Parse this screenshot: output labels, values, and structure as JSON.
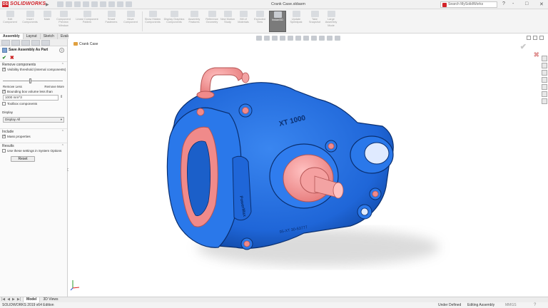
{
  "app": {
    "brand": "SOLIDWORKS",
    "document_title": "Crank Case.sldasm",
    "search_placeholder": "Search MySolidWorks",
    "window_controls": [
      "?",
      "-",
      "□",
      "✕"
    ]
  },
  "commands": [
    {
      "label": "Edit Component"
    },
    {
      "label": "Insert Components"
    },
    {
      "label": "Mate"
    },
    {
      "label": "Component Preview Window"
    },
    {
      "label": "Linear Component Pattern"
    },
    {
      "label": "Smart Fasteners"
    },
    {
      "label": "Move Component"
    },
    {
      "label": "Show Hidden Components"
    },
    {
      "label": "Display Graphics Components"
    },
    {
      "label": "Assembly Features"
    },
    {
      "label": "Reference Geometry"
    },
    {
      "label": "New Motion Study"
    },
    {
      "label": "Bill of Materials"
    },
    {
      "label": "Exploded View"
    },
    {
      "label": "Instant3D"
    },
    {
      "label": "Update Speedpak"
    },
    {
      "label": "Take Snapshot"
    },
    {
      "label": "Large Assembly Mode"
    }
  ],
  "tabs": [
    "Assembly",
    "Layout",
    "Sketch",
    "Evaluate"
  ],
  "property_manager": {
    "title": "Save Assembly As Part",
    "help": "?",
    "ok": "✔",
    "cancel": "✖",
    "remove_components": {
      "heading": "Remove components",
      "visibility_label": "Visibility threshold (internal components)",
      "visibility_checked": true,
      "slider_value": 0.45,
      "remove_less": "Remove Less",
      "remove_more": "Remove More",
      "bbox_label": "Bounding box volume less than",
      "bbox_checked": true,
      "bbox_value": "1000 mm^3",
      "toolbox_label": "Toolbox components",
      "toolbox_checked": false
    },
    "display": {
      "heading": "Display",
      "selected": "Display All"
    },
    "include": {
      "heading": "Include",
      "mass_label": "Mass properties",
      "mass_checked": true
    },
    "results": {
      "heading": "Results",
      "use_settings_label": "Use these settings in System Options",
      "use_settings_checked": false,
      "reset": "Reset"
    }
  },
  "viewport": {
    "tree_root": "Crank Case",
    "model_text_top": "XT 1000",
    "model_text_side": "PowerMax",
    "model_text_bottom": "95-XT 30-63777",
    "colors": {
      "housing": "#1f6fe0",
      "housing_dark": "#0c3f95",
      "parts": "#f08a8a"
    }
  },
  "bottom_tabs": [
    "Model",
    "3D Views"
  ],
  "status": {
    "edition": "SOLIDWORKS 2019 x64 Edition",
    "definition": "Under Defined",
    "mode": "Editing Assembly",
    "units": "MMGS"
  }
}
